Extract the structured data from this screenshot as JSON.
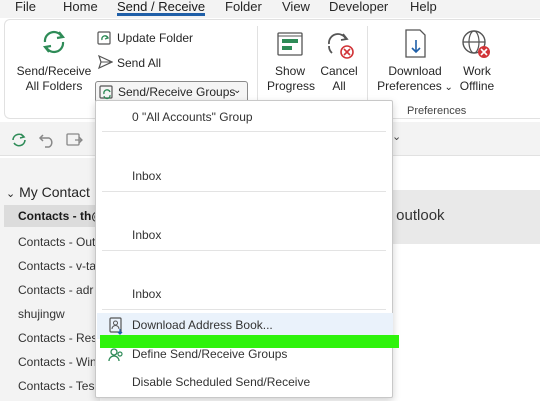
{
  "menu": {
    "tabs": [
      "File",
      "Home",
      "Send / Receive",
      "Folder",
      "View",
      "Developer",
      "Help"
    ],
    "active_tab": "Send / Receive"
  },
  "ribbon": {
    "send_receive_all": [
      "Send/Receive",
      "All Folders"
    ],
    "update_folder": "Update Folder",
    "send_all": "Send All",
    "send_receive_groups": "Send/Receive Groups",
    "show_progress": [
      "Show",
      "Progress"
    ],
    "cancel_all": [
      "Cancel",
      "All"
    ],
    "download_preferences": [
      "Download",
      "Preferences"
    ],
    "work_offline": [
      "Work",
      "Offline"
    ],
    "group_preferences": "Preferences"
  },
  "nav": {
    "header": "My Contact",
    "items": [
      {
        "label": "Contacts - th@",
        "selected": true
      },
      {
        "label": "Contacts - Out",
        "selected": false
      },
      {
        "label": "Contacts - v-ta",
        "selected": false
      },
      {
        "label": "Contacts - adr",
        "selected": false
      },
      {
        "label": "shujingw",
        "selected": false
      },
      {
        "label": "Contacts - Res",
        "selected": false
      },
      {
        "label": "Contacts - Win",
        "selected": false
      },
      {
        "label": "Contacts - Tes",
        "selected": false
      }
    ]
  },
  "content": {
    "banner": "ing outlook"
  },
  "dropdown": {
    "items": [
      {
        "label": "0 \"All Accounts\" Group"
      },
      {
        "label": "Inbox"
      },
      {
        "label": "Inbox"
      },
      {
        "label": "Inbox"
      },
      {
        "label": "Download Address Book...",
        "icon": "address-book-icon"
      },
      {
        "label": "Define Send/Receive Groups",
        "icon": "groups-icon"
      },
      {
        "label": "Disable Scheduled Send/Receive"
      }
    ]
  },
  "colors": {
    "accent": "#1f5fa8",
    "green_icon": "#2e8b57",
    "highlight_bar": "#2ef30b",
    "red_icon": "#d13438"
  }
}
